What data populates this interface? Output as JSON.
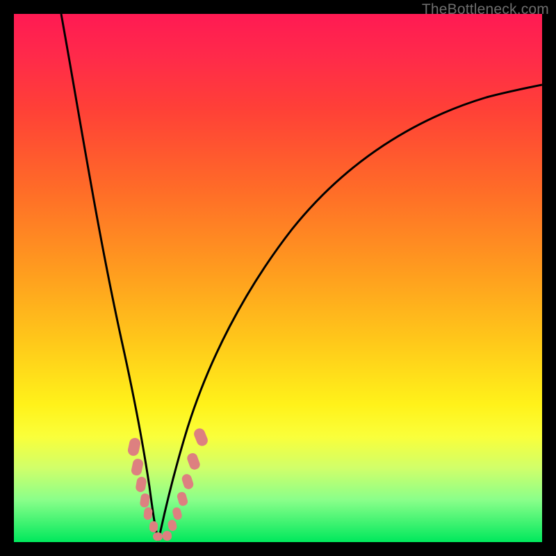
{
  "watermark": "TheBottleneck.com",
  "chart_data": {
    "type": "line",
    "title": "",
    "xlabel": "",
    "ylabel": "",
    "xlim": [
      0,
      100
    ],
    "ylim": [
      0,
      100
    ],
    "grid": false,
    "legend": false,
    "series": [
      {
        "name": "left-curve",
        "color": "#000000",
        "x": [
          9,
          12,
          15,
          18,
          20,
          22,
          23,
          24,
          25,
          26,
          27
        ],
        "y": [
          100,
          80,
          58,
          38,
          25,
          15,
          10,
          6,
          3,
          1,
          0
        ]
      },
      {
        "name": "right-curve",
        "color": "#000000",
        "x": [
          27,
          28,
          29,
          30,
          32,
          35,
          40,
          50,
          60,
          70,
          80,
          90,
          100
        ],
        "y": [
          0,
          2,
          5,
          9,
          16,
          25,
          37,
          54,
          65,
          73,
          79,
          83,
          86
        ]
      }
    ],
    "markers": [
      {
        "name": "valley-markers",
        "color": "#d97b7b",
        "shape": "rounded-rect",
        "points": [
          {
            "x": 22.5,
            "y": 18
          },
          {
            "x": 22.8,
            "y": 14
          },
          {
            "x": 23.5,
            "y": 10
          },
          {
            "x": 24,
            "y": 7
          },
          {
            "x": 24.5,
            "y": 5
          },
          {
            "x": 25.5,
            "y": 2
          },
          {
            "x": 26.5,
            "y": 0.5
          },
          {
            "x": 27.5,
            "y": 0.5
          },
          {
            "x": 28.5,
            "y": 2.5
          },
          {
            "x": 29.2,
            "y": 5
          },
          {
            "x": 30,
            "y": 8
          },
          {
            "x": 31,
            "y": 12
          },
          {
            "x": 32,
            "y": 16
          },
          {
            "x": 33.5,
            "y": 22
          }
        ]
      }
    ],
    "gradient_stops": [
      {
        "pos": 0,
        "color": "#ff1a53"
      },
      {
        "pos": 8,
        "color": "#ff2a4a"
      },
      {
        "pos": 18,
        "color": "#ff4037"
      },
      {
        "pos": 33,
        "color": "#ff6b28"
      },
      {
        "pos": 48,
        "color": "#ff9a1f"
      },
      {
        "pos": 62,
        "color": "#ffc81a"
      },
      {
        "pos": 74,
        "color": "#fff21a"
      },
      {
        "pos": 80,
        "color": "#faff3a"
      },
      {
        "pos": 86,
        "color": "#d0ff6a"
      },
      {
        "pos": 92,
        "color": "#8aff8a"
      },
      {
        "pos": 100,
        "color": "#00e85c"
      }
    ]
  }
}
